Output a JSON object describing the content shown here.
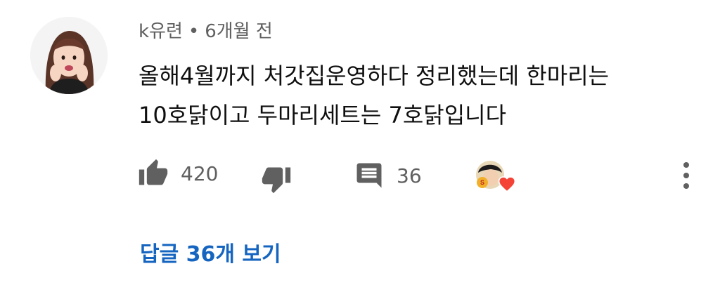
{
  "comment": {
    "author": "k유련",
    "separator": "•",
    "time_ago": "6개월 전",
    "text_line1": "올해4월까지 처갓집운영하다 정리했는데 한마리는",
    "text_line2": "10호닭이고 두마리세트는 7호닭입니다"
  },
  "actions": {
    "like_icon": "thumbs-up-icon",
    "like_count": "420",
    "dislike_icon": "thumbs-down-icon",
    "reply_icon": "comment-icon",
    "reply_count": "36",
    "creator_heart": "heart-icon",
    "menu_icon": "more-vert-icon"
  },
  "replies": {
    "label": "답글 36개 보기"
  },
  "colors": {
    "text": "#0f0f0f",
    "secondary": "#606060",
    "link": "#1565c0",
    "heart": "#f44336"
  }
}
